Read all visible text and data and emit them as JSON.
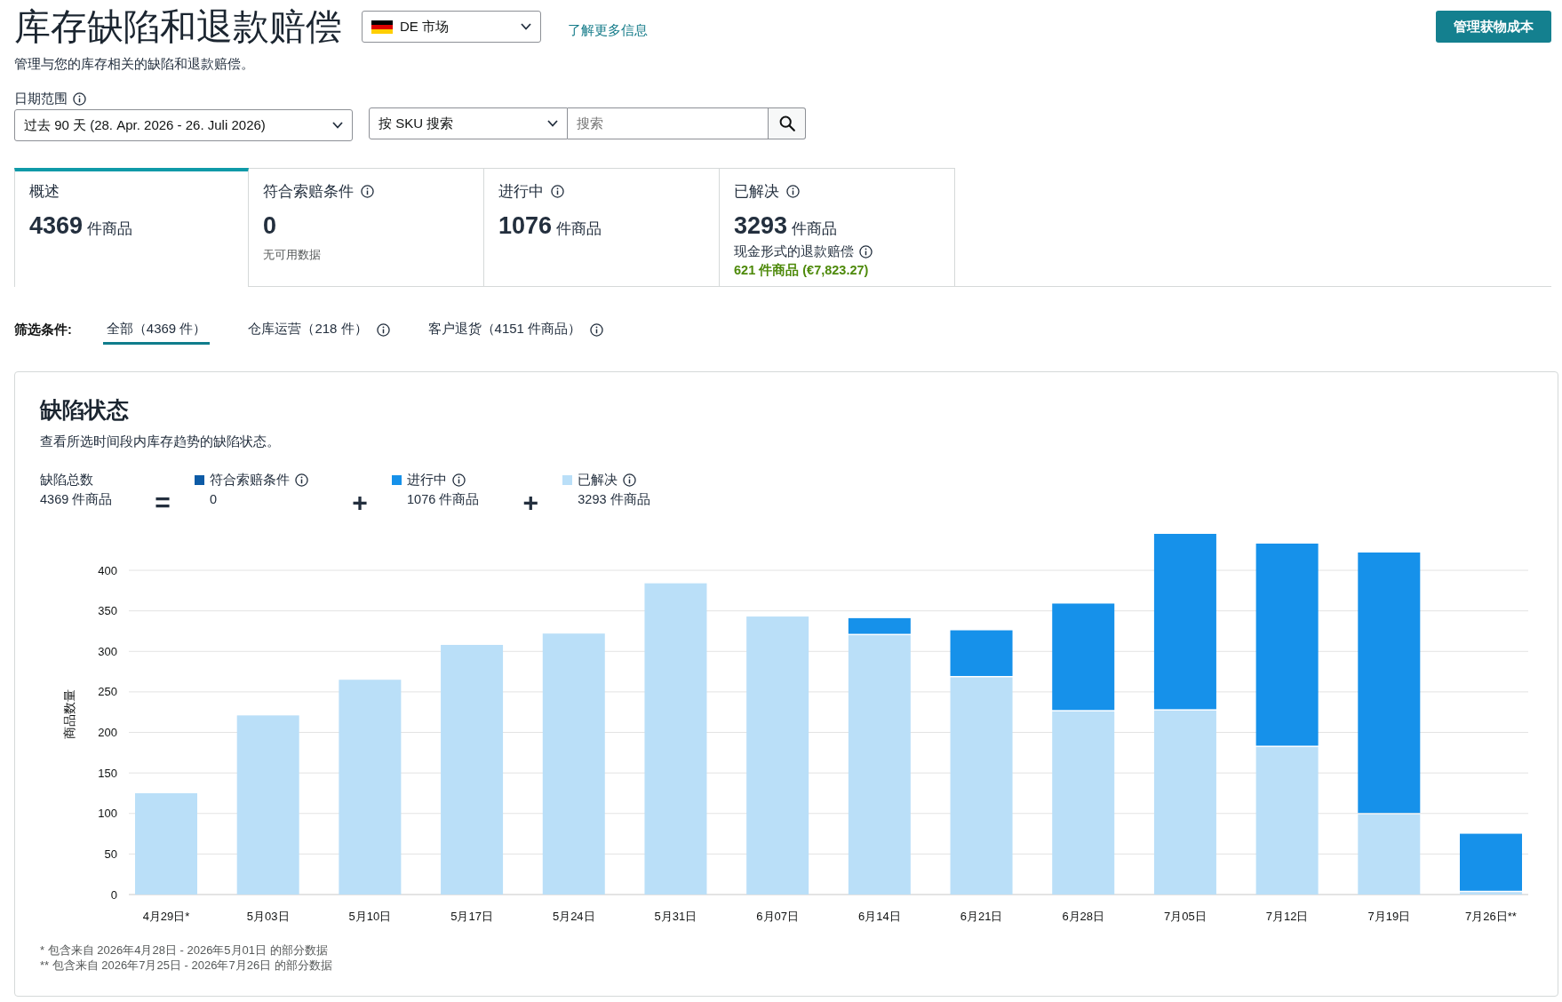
{
  "header": {
    "title": "库存缺陷和退款赔偿",
    "marketplace_dropdown": "DE 市场",
    "learn_more_link": "了解更多信息",
    "manage_button": "管理获物成本",
    "subtitle": "管理与您的库存相关的缺陷和退款赔偿。"
  },
  "date_range": {
    "label": "日期范围",
    "value": "过去 90 天 (28. Apr. 2026 - 26. Juli 2026)"
  },
  "search": {
    "type": "按 SKU 搜索",
    "placeholder": "搜索"
  },
  "summary_tabs": [
    {
      "label": "概述",
      "info": false,
      "count": "4369",
      "unit": "件商品",
      "selected": true
    },
    {
      "label": "符合索赔条件",
      "info": true,
      "count": "0",
      "note": "无可用数据",
      "selected": false
    },
    {
      "label": "进行中",
      "info": true,
      "count": "1076",
      "unit": "件商品",
      "selected": false
    },
    {
      "label": "已解决",
      "info": true,
      "count": "3293",
      "unit": "件商品",
      "selected": false,
      "reimbursement": {
        "label": "现金形式的退款赔偿",
        "value": "621 件商品 (€7,823.27)"
      }
    }
  ],
  "filter": {
    "label": "筛选条件:",
    "tabs": [
      {
        "label": "全部（4369 件）",
        "info": false,
        "selected": true
      },
      {
        "label": "仓库运营（218 件）",
        "info": true,
        "selected": false
      },
      {
        "label": "客户退货（4151 件商品）",
        "info": true,
        "selected": false
      }
    ]
  },
  "defect_status": {
    "title": "缺陷状态",
    "description": "查看所选时间段内库存趋势的缺陷状态。",
    "total": {
      "label": "缺陷总数",
      "value": "4369 件商品"
    },
    "legend": [
      {
        "operator": "=",
        "value": "0"
      },
      {
        "operator": "+",
        "value": "1076 件商品"
      },
      {
        "operator": "+",
        "value": "3293 件商品"
      }
    ],
    "chart_data": {
      "type": "bar",
      "stacked": true,
      "grid": true,
      "ylabel": "商品数量",
      "categories": [
        "4月29日*",
        "5月03日",
        "5月10日",
        "5月17日",
        "5月24日",
        "5月31日",
        "6月07日",
        "6月14日",
        "6月21日",
        "6月28日",
        "7月05日",
        "7月12日",
        "7月19日",
        "7月26日**"
      ],
      "series": [
        {
          "name": "符合索赔条件",
          "color": "#0d5ba6",
          "values": [
            0,
            0,
            0,
            0,
            0,
            0,
            0,
            0,
            0,
            0,
            0,
            0,
            0,
            0
          ]
        },
        {
          "name": "进行中",
          "color": "#1691ea",
          "values": [
            0,
            0,
            0,
            0,
            0,
            0,
            0,
            21,
            58,
            133,
            218,
            251,
            323,
            72
          ]
        },
        {
          "name": "已解决",
          "color": "#badff8",
          "values": [
            125,
            221,
            265,
            308,
            322,
            384,
            343,
            320,
            268,
            226,
            227,
            182,
            99,
            3
          ]
        }
      ],
      "ylim": [
        0,
        445
      ],
      "yticks": [
        0,
        50,
        100,
        150,
        200,
        250,
        300,
        350,
        400
      ]
    },
    "footnotes": [
      "* 包含来自 2026年4月28日 - 2026年5月01日 的部分数据",
      "** 包含来自 2026年7月25日 - 2026年7月26日 的部分数据"
    ]
  }
}
